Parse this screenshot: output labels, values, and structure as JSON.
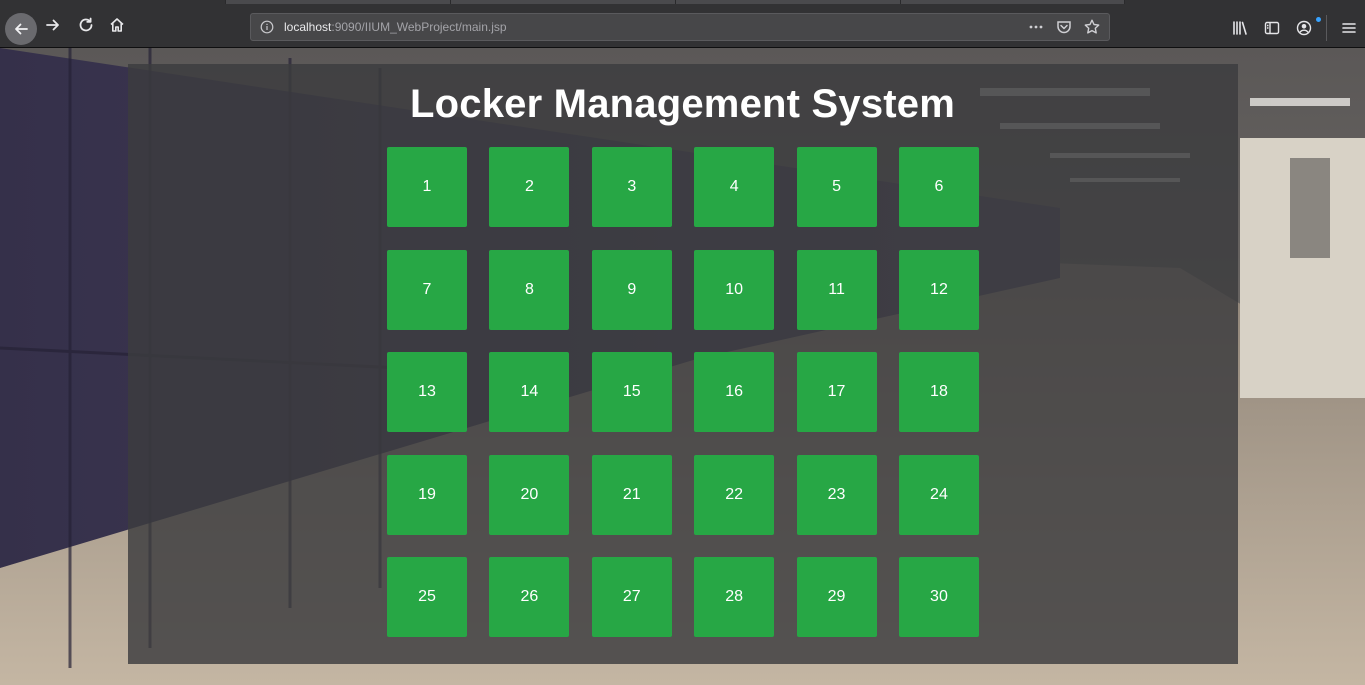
{
  "browser": {
    "url_host": "localhost",
    "url_rest": ":9090/IIUM_WebProject/main.jsp",
    "icons": {
      "back": "back-arrow-icon",
      "forward": "forward-arrow-icon",
      "reload": "reload-icon",
      "home": "home-icon",
      "site_info": "info-icon",
      "page_actions": "more-dots-icon",
      "pocket": "pocket-icon",
      "bookmark": "star-icon",
      "library": "library-icon",
      "sidebar": "sidebar-icon",
      "account": "account-icon",
      "menu": "hamburger-menu-icon"
    }
  },
  "page": {
    "title": "Locker Management System",
    "accent_color": "#27a745",
    "lockers": [
      "1",
      "2",
      "3",
      "4",
      "5",
      "6",
      "7",
      "8",
      "9",
      "10",
      "11",
      "12",
      "13",
      "14",
      "15",
      "16",
      "17",
      "18",
      "19",
      "20",
      "21",
      "22",
      "23",
      "24",
      "25",
      "26",
      "27",
      "28",
      "29",
      "30"
    ]
  }
}
